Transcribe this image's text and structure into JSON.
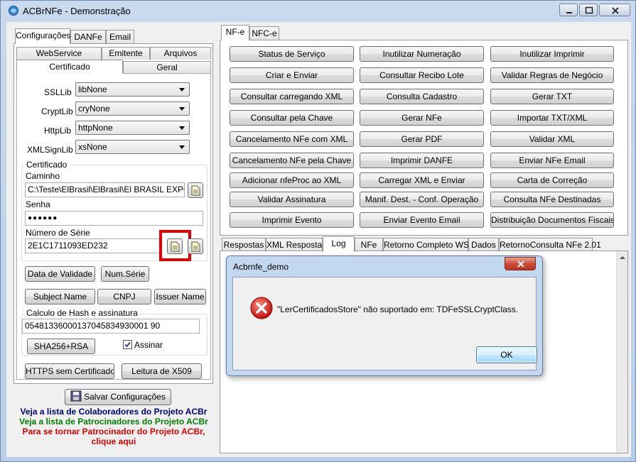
{
  "window": {
    "title": "ACBrNFe - Demonstração"
  },
  "left": {
    "tabs": [
      "Configurações",
      "DANFe",
      "Email"
    ],
    "subtabs_row1": [
      "WebService",
      "Emitente",
      "Arquivos"
    ],
    "subtabs_row2": [
      "Certificado",
      "Geral"
    ],
    "libs": [
      {
        "label": "SSLLib",
        "value": "libNone"
      },
      {
        "label": "CryptLib",
        "value": "cryNone"
      },
      {
        "label": "HttpLib",
        "value": "httpNone"
      },
      {
        "label": "XMLSignLib",
        "value": "xsNone"
      }
    ],
    "certificado": {
      "group_label": "Certificado",
      "caminho_label": "Caminho",
      "caminho_value": "C:\\Teste\\ElBrasil\\ElBrasil\\El BRASIL EXPOR",
      "senha_label": "Senha",
      "senha_value": "●●●●●●",
      "serie_label": "Número de Série",
      "serie_value": "2E1C1711093ED232"
    },
    "buttons": {
      "data_validade": "Data de Validade",
      "num_serie": "Num.Série",
      "subject_name": "Subject Name",
      "cnpj": "CNPJ",
      "issuer_name": "Issuer Name",
      "sha256": "SHA256+RSA",
      "https": "HTTPS sem Certificado",
      "x509": "Leitura de X509"
    },
    "hash": {
      "group_label": "Calculo de Hash e assinatura",
      "value": "05481336000137045834930001 90",
      "assinar_label": "Assinar",
      "assinar_checked": true
    },
    "salvar": "Salvar Configurações",
    "links": [
      {
        "text": "Veja a lista de Colaboradores do Projeto ACBr",
        "color": "#00007f"
      },
      {
        "text": "Veja a lista de Patrocinadores do Projeto ACBr",
        "color": "#007f00"
      },
      {
        "text": "Para se tornar Patrocinador do Projeto ACBr,",
        "color": "#e00000"
      },
      {
        "text": "clique aqui",
        "color": "#e00000"
      }
    ]
  },
  "right": {
    "tabs": [
      "NF-e",
      "NFC-e"
    ],
    "buttons": [
      [
        "Status de Serviço",
        "Inutilizar Numeração",
        "Inutilizar Imprimir"
      ],
      [
        "Criar e Enviar",
        "Consultar Recibo Lote",
        "Validar Regras de Negócio"
      ],
      [
        "Consultar carregando XML",
        "Consulta Cadastro",
        "Gerar TXT"
      ],
      [
        "Consultar pela Chave",
        "Gerar NFe",
        "Importar TXT/XML"
      ],
      [
        "Cancelamento NFe com XML",
        "Gerar PDF",
        "Validar XML"
      ],
      [
        "Cancelamento NFe pela Chave",
        "Imprimir DANFE",
        "Enviar NFe Email"
      ],
      [
        "Adicionar nfeProc ao XML",
        "Carregar XML e Enviar",
        "Carta de Correção"
      ],
      [
        "Validar Assinatura",
        "Manif. Dest. - Conf. Operação",
        "Consulta NFe Destinadas"
      ],
      [
        "Imprimir Evento",
        "Enviar Evento Email",
        "Distribuição Documentos Fiscais"
      ]
    ],
    "bottom_tabs": [
      "Respostas",
      "XML Resposta",
      "Log",
      "NFe",
      "Retorno Completo WS",
      "Dados",
      "RetornoConsulta NFe 2.01"
    ]
  },
  "dialog": {
    "title": "Acbrnfe_demo",
    "message": "\"LerCertificadosStore\" não suportado em: TDFeSSLCryptClass.",
    "ok": "OK"
  }
}
